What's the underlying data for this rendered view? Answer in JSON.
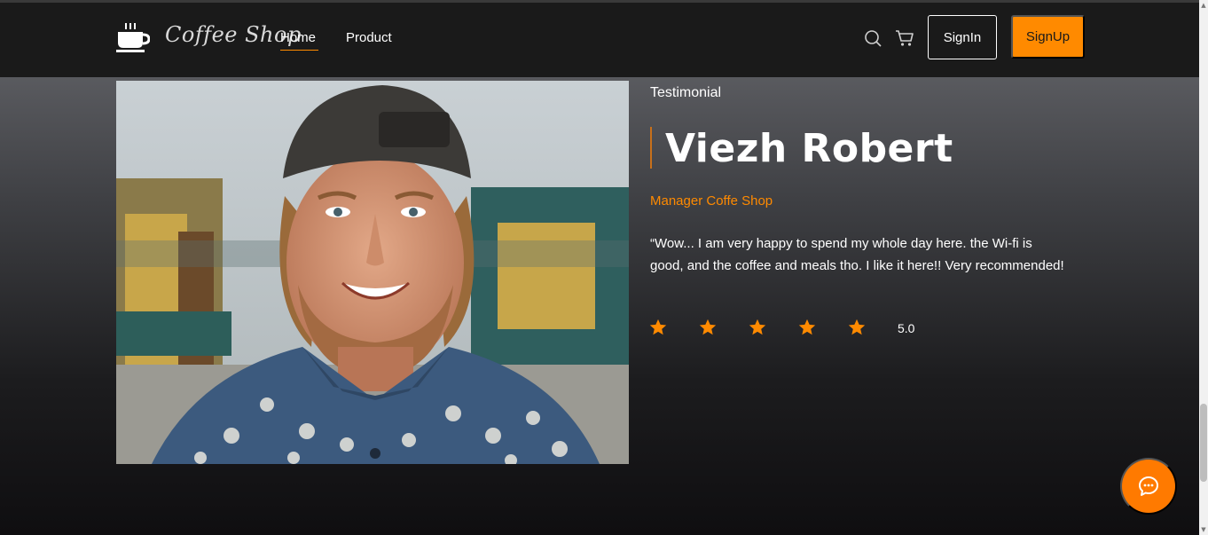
{
  "brand": {
    "name": "Coffee Shop",
    "logo_icon": "coffee-cup-icon"
  },
  "nav": {
    "items": [
      {
        "label": "Home",
        "active": true
      },
      {
        "label": "Product",
        "active": false
      }
    ],
    "search_icon": "search-icon",
    "cart_icon": "cart-icon",
    "signin_label": "SignIn",
    "signup_label": "SignUp"
  },
  "testimonial": {
    "eyebrow": "Testimonial",
    "name": "Viezh Robert",
    "role": "Manager Coffe Shop",
    "quote": "“Wow... I am very happy to spend my whole day here. the Wi-fi is good, and the coffee and meals tho. I like it here!! Very recommended!",
    "stars": 5,
    "rating": "5.0",
    "photo_icon": "portrait-photo"
  },
  "chat": {
    "icon": "chat-bubble-icon"
  },
  "colors": {
    "accent": "#ff8a00",
    "navbar": "#1a1a1a",
    "text": "#ffffff"
  }
}
